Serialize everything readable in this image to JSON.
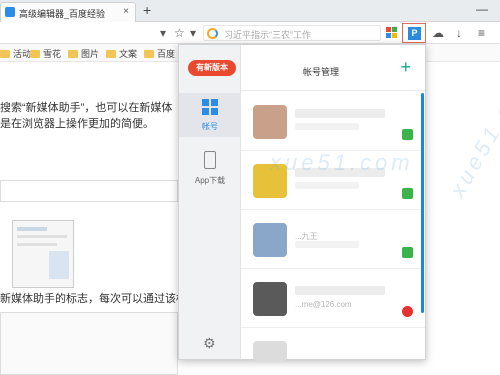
{
  "tab": {
    "title": "高级编辑器_百度经验",
    "close": "×"
  },
  "newtab": "+",
  "window": {
    "minimize": "—"
  },
  "toolbar": {
    "arrow": "▾",
    "star": "☆",
    "dropdown": "▾",
    "url_placeholder": "习近平指示“三农”工作",
    "cloud": "☁",
    "download": "↓",
    "menu": "≡"
  },
  "bookmarks": [
    "活动",
    "雪花",
    "图片",
    "文案",
    "百度"
  ],
  "page": {
    "line1": "搜索“新媒体助手”，也可以在新媒体",
    "line2": "是在浏览器上操作更加的简便。",
    "line3": "新媒体助手的标志，每次可以通过该标"
  },
  "panel": {
    "new_version": "有新版本",
    "title": "帐号管理",
    "add": "+",
    "sidebar": [
      {
        "label": "帐号",
        "icon": "grid-icon",
        "active": true
      },
      {
        "label": "App下载",
        "icon": "phone-icon",
        "active": false
      }
    ],
    "settings_icon": "⚙",
    "accounts": [
      {
        "platform": "wechat",
        "platform_color": "#3cb34a",
        "avatar_color": "#c9a08a",
        "name_text": "",
        "sub_text": ""
      },
      {
        "platform": "wechat",
        "platform_color": "#3cb34a",
        "avatar_color": "#e8c13a",
        "name_text": "",
        "sub_text": ""
      },
      {
        "platform": "wechat",
        "platform_color": "#3cb34a",
        "avatar_color": "#8aa6c8",
        "name_text": "...九王",
        "sub_text": ""
      },
      {
        "platform": "weibo",
        "platform_color": "#e8312f",
        "avatar_color": "#5a5a5a",
        "name_text": "",
        "sub_text": "...me@126.com"
      }
    ]
  },
  "colors": {
    "accent": "#2b8de8",
    "danger": "#e8492f",
    "green": "#17a88a"
  },
  "watermark": "xue51.com"
}
